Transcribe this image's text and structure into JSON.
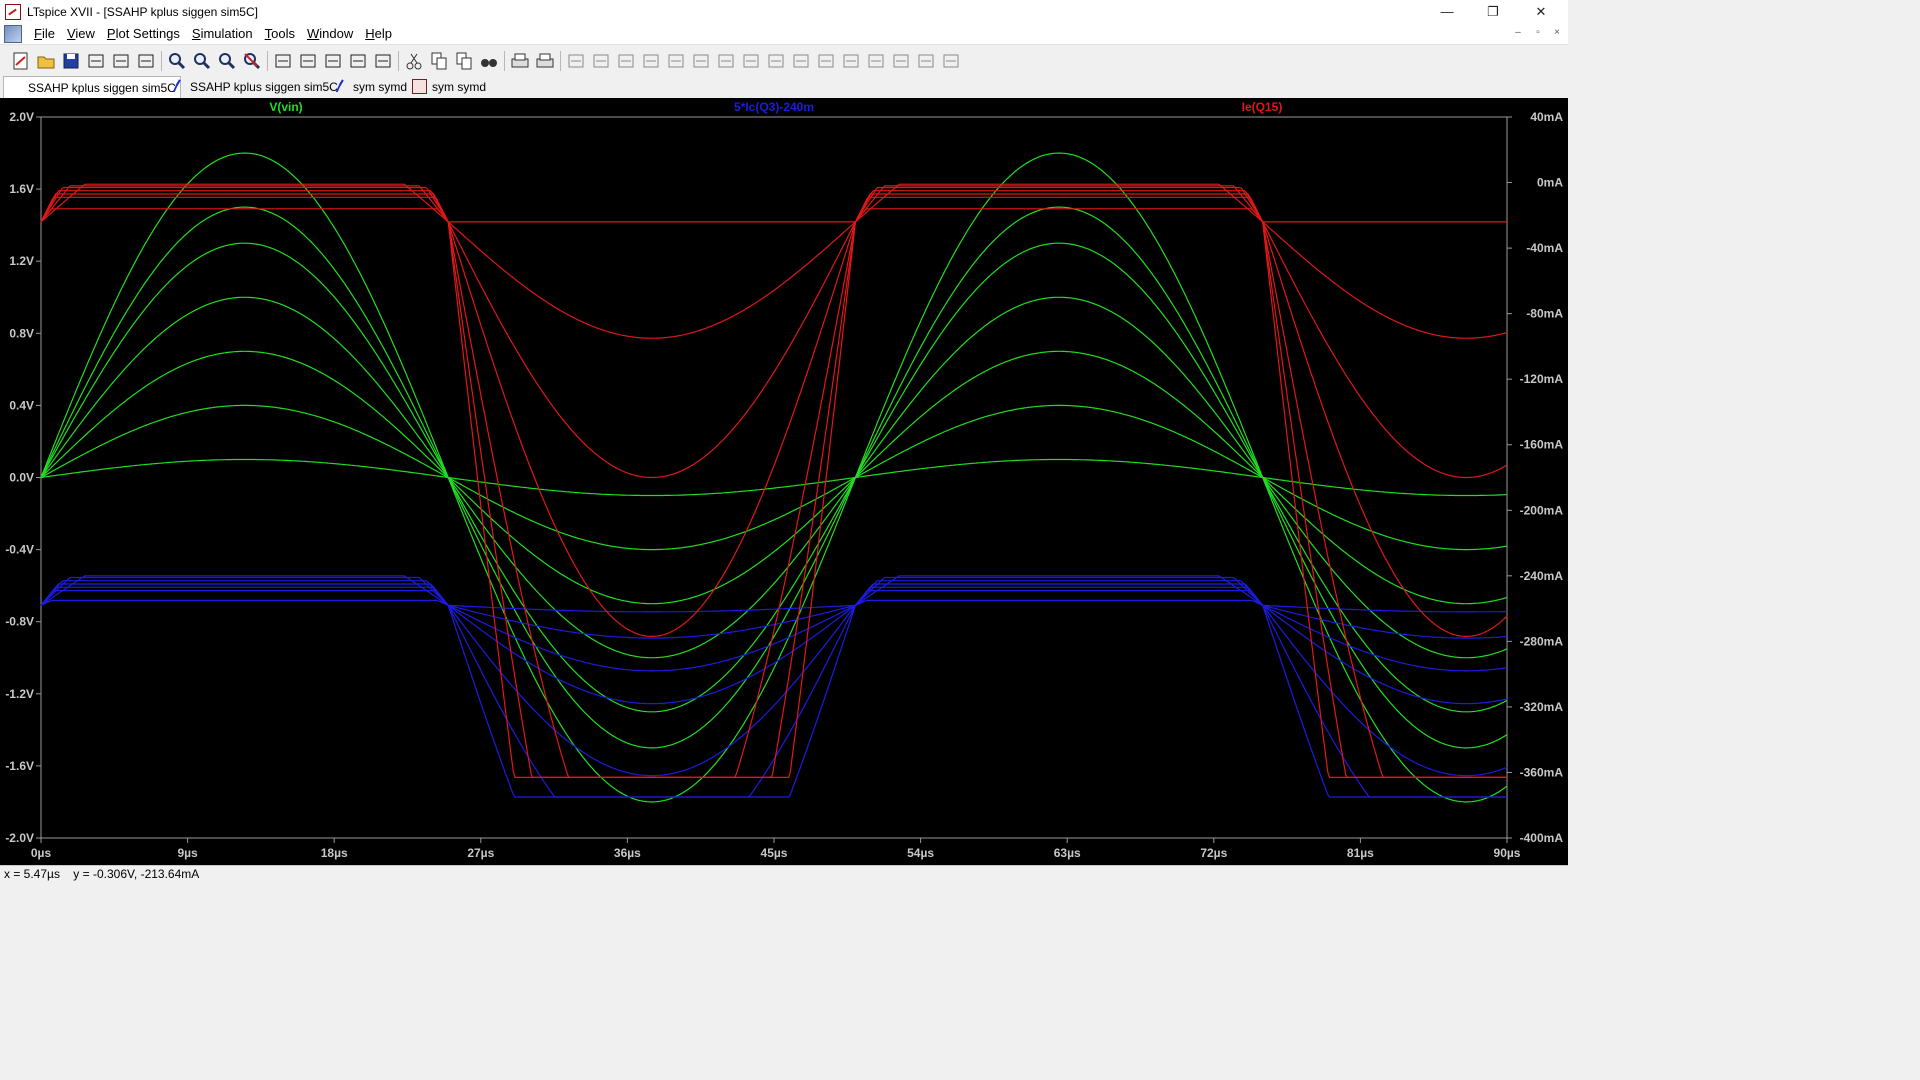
{
  "window": {
    "title": "LTspice XVII - [SSAHP kplus siggen sim5C]",
    "minimize": "—",
    "maximize": "❐",
    "close": "✕"
  },
  "menu": [
    "File",
    "View",
    "Plot Settings",
    "Simulation",
    "Tools",
    "Window",
    "Help"
  ],
  "mdi_controls": [
    "–",
    "▫",
    "×"
  ],
  "toolbar_icons": [
    "new-schematic-icon",
    "open-icon",
    "save-icon",
    "control-panel-icon",
    "run-icon",
    "halt-icon",
    "zoom-in-icon",
    "zoom-out-icon",
    "zoom-box-icon",
    "zoom-cancel-icon",
    "autorange-icon",
    "fit-icon",
    "tile-icon",
    "cascade-icon",
    "window-icon",
    "cut-icon",
    "copy-icon",
    "paste-icon",
    "find-icon",
    "print-icon",
    "print-preview-icon",
    "wire-icon",
    "ground-icon",
    "label-icon",
    "resistor-icon",
    "capacitor-icon",
    "inductor-icon",
    "diode-icon",
    "component-icon",
    "move-icon",
    "drag-icon",
    "undo-icon",
    "redo-icon",
    "rotate-icon",
    "mirror-icon",
    "text-icon",
    "spice-directive-icon"
  ],
  "tabs": [
    {
      "label": "SSAHP kplus siggen sim5C",
      "icon": "plot-icon",
      "active": true
    },
    {
      "label": "SSAHP kplus siggen sim5C",
      "icon": "schematic-icon",
      "active": false
    },
    {
      "label": "sym symd",
      "icon": "schematic-icon",
      "active": false
    },
    {
      "label": "sym symd",
      "icon": "symbol-icon",
      "active": false
    }
  ],
  "status": {
    "x": "x = 5.47µs",
    "y": "y = -0.306V, -213.64mA"
  },
  "colors": {
    "background": "#000000",
    "grid": "#9a9a9a",
    "vin": "#22dd22",
    "ic": "#1c1ce0",
    "ie": "#e01818",
    "axis_text": "#c8c8c8"
  },
  "chart_data": {
    "type": "line",
    "x_unit": "µs",
    "xlim": [
      0,
      90
    ],
    "x_ticks": [
      "0µs",
      "9µs",
      "18µs",
      "27µs",
      "36µs",
      "45µs",
      "54µs",
      "63µs",
      "72µs",
      "81µs",
      "90µs"
    ],
    "y_left_ticks": [
      "2.0V",
      "1.6V",
      "1.2V",
      "0.8V",
      "0.4V",
      "0.0V",
      "-0.4V",
      "-0.8V",
      "-1.2V",
      "-1.6V",
      "-2.0V"
    ],
    "y_left_lim": [
      -2.0,
      2.0
    ],
    "y_right_ticks": [
      "40mA",
      "0mA",
      "-40mA",
      "-80mA",
      "-120mA",
      "-160mA",
      "-200mA",
      "-240mA",
      "-280mA",
      "-320mA",
      "-360mA",
      "-400mA"
    ],
    "y_right_lim": [
      -400,
      40
    ],
    "grid": false,
    "period_us": 50,
    "traces": [
      {
        "name": "V(vin)",
        "axis": "left",
        "color": "#22dd22",
        "amplitudes_V": [
          0.1,
          0.4,
          0.7,
          1.0,
          1.3,
          1.5,
          1.8
        ],
        "negative_peaks_V": [
          -0.1,
          -0.4,
          -0.7,
          -1.0,
          -1.3,
          -1.5,
          -1.8
        ]
      },
      {
        "name": "5*Ic(Q3)-240m",
        "axis": "right",
        "color": "#1c1ce0",
        "idle_mA": -258,
        "top_levels_mA": [
          -240,
          -241,
          -243,
          -245,
          -247,
          -249,
          -255
        ],
        "bottom_levels_mA": [
          -262,
          -278,
          -298,
          -318,
          -335,
          -352,
          -375
        ],
        "clip_min_mA": -350
      },
      {
        "name": "Ie(Q15)",
        "axis": "right",
        "color": "#e01818",
        "idle_mA": -24,
        "top_levels_mA": [
          -1,
          -2,
          -3,
          -5,
          -7,
          -9,
          -16
        ],
        "bottom_levels_mA": [
          -24,
          -95,
          -180,
          -277,
          -338,
          -356,
          -364
        ],
        "clip_min_mA": -363
      }
    ]
  }
}
